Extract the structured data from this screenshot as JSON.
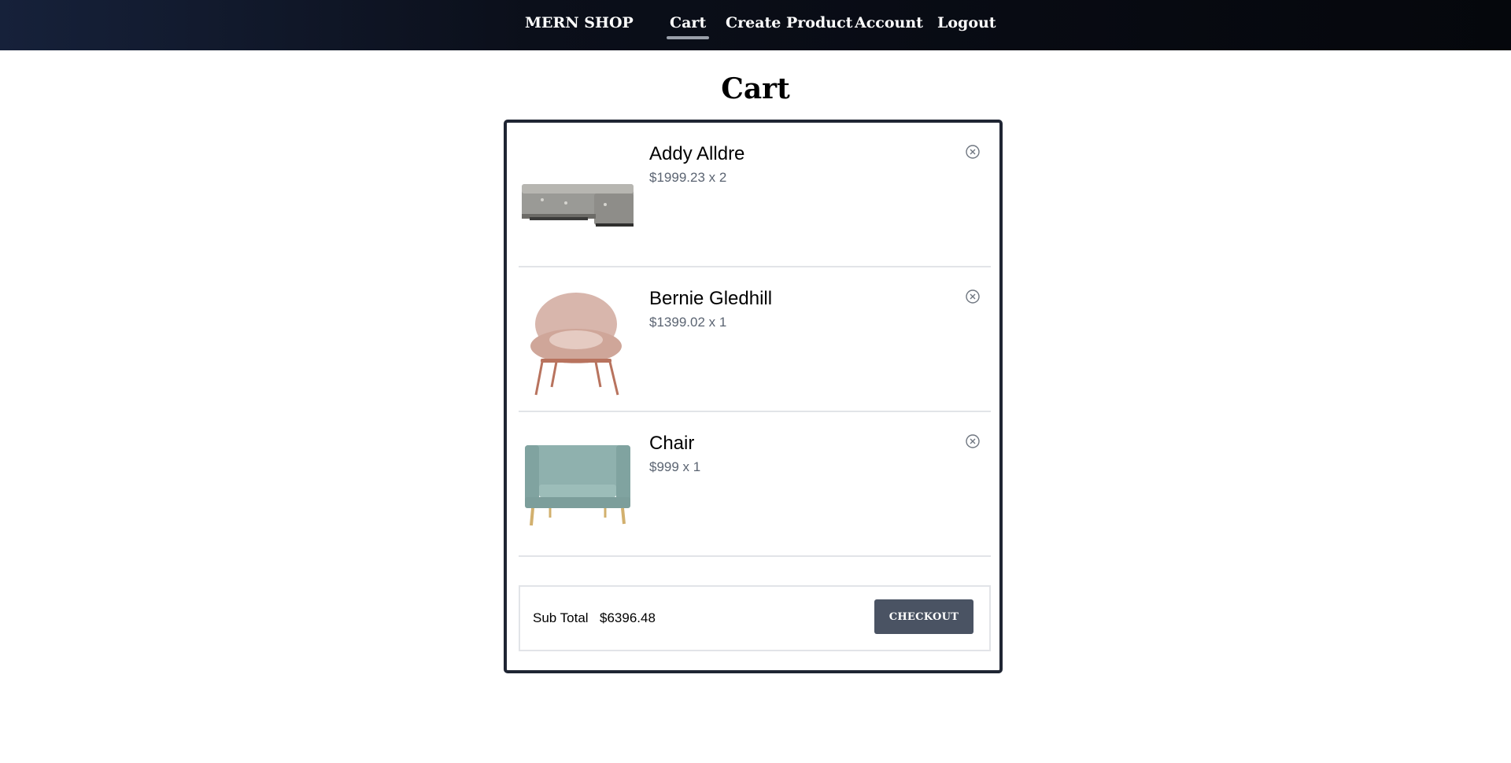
{
  "nav": {
    "brand": "MERN SHOP",
    "links": [
      {
        "label": "Cart",
        "active": true
      },
      {
        "label": "Create Product"
      },
      {
        "label": "Account"
      },
      {
        "label": "Logout"
      }
    ]
  },
  "page": {
    "title": "Cart"
  },
  "cart": {
    "items": [
      {
        "name": "Addy Alldre",
        "price_line": "$1999.23 x 2",
        "image": "gray-sectional-sofa",
        "remove_icon": "close-circle-icon"
      },
      {
        "name": "Bernie Gledhill",
        "price_line": "$1399.02 x 1",
        "image": "pink-lounge-chair",
        "remove_icon": "close-circle-icon"
      },
      {
        "name": "Chair",
        "price_line": "$999 x 1",
        "image": "teal-loveseat",
        "remove_icon": "close-circle-icon"
      }
    ],
    "subtotal_label": "Sub Total",
    "subtotal_value": "$6396.48",
    "checkout_label": "CHECKOUT"
  },
  "colors": {
    "nav_bg": "#0b0f1a",
    "accent_underline": "#9aa0aa",
    "card_border": "#1f2533",
    "checkout_bg": "#4a5363",
    "price_text": "#5b6472"
  }
}
